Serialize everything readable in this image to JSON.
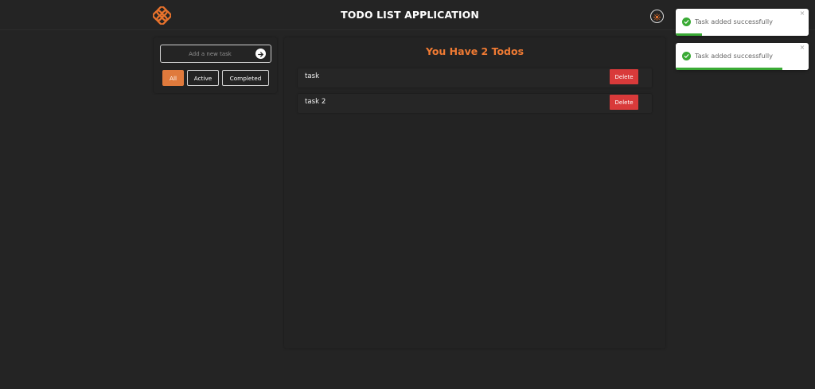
{
  "header": {
    "title": "TODO LIST APPLICATION",
    "logo_icon": "flower-logo-icon",
    "theme_toggle_icon": "sun-icon",
    "accent_color": "#e8722c"
  },
  "sidebar": {
    "input": {
      "placeholder": "Add a new task",
      "value": ""
    },
    "submit_icon": "arrow-right-icon",
    "filters": [
      {
        "label": "All",
        "active": true
      },
      {
        "label": "Active",
        "active": false
      },
      {
        "label": "Completed",
        "active": false
      }
    ]
  },
  "main": {
    "heading": "You Have 2 Todos",
    "todos": [
      {
        "text": "task",
        "delete_label": "Delete"
      },
      {
        "text": "task 2",
        "delete_label": "Delete"
      }
    ]
  },
  "toasts": [
    {
      "message": "Task added successfully",
      "close_label": "×",
      "icon": "check-circle-icon",
      "progress_remaining": 0.2
    },
    {
      "message": "Task added successfully",
      "close_label": "×",
      "icon": "check-circle-icon",
      "progress_remaining": 0.8
    }
  ],
  "colors": {
    "background": "#242424",
    "heading": "#ef7a33",
    "active_filter": "#e07a3c",
    "delete_button": "#d93a3a",
    "success": "#3aaa35"
  }
}
